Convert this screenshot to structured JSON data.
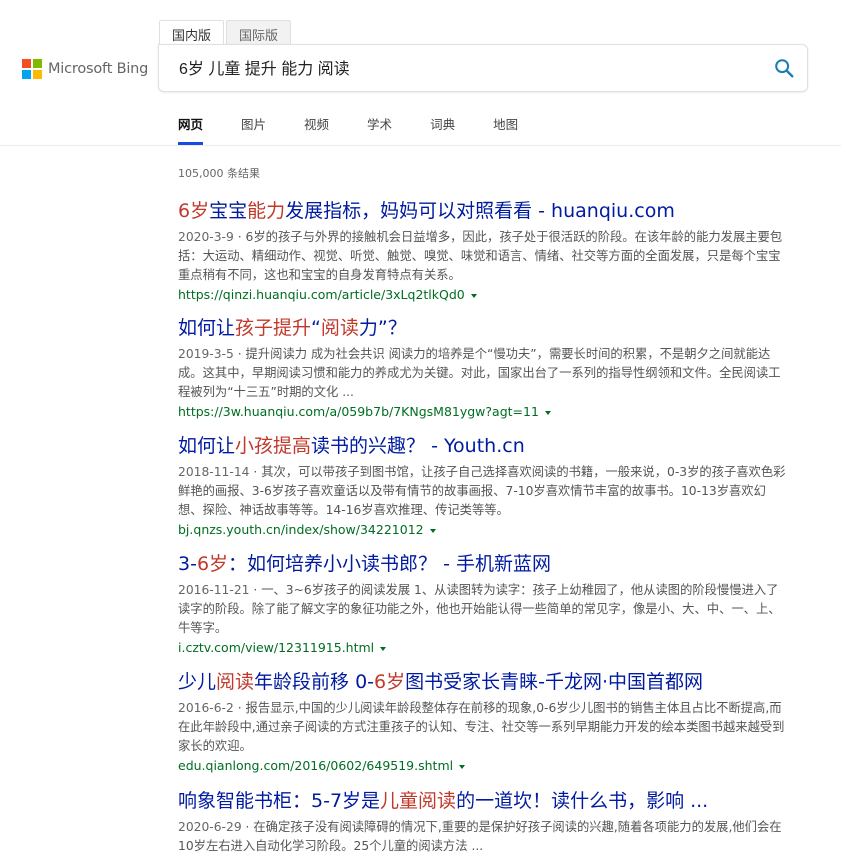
{
  "brand": {
    "logo_text": "Microsoft Bing",
    "colors": [
      "#f25022",
      "#7fba00",
      "#00a4ef",
      "#ffb900"
    ]
  },
  "scope_tabs": [
    {
      "label": "国内版",
      "active": true
    },
    {
      "label": "国际版",
      "active": false
    }
  ],
  "search": {
    "query": "6岁 儿童 提升 能力 阅读",
    "icon": "search-icon"
  },
  "nav": [
    {
      "label": "网页",
      "active": true
    },
    {
      "label": "图片",
      "active": false
    },
    {
      "label": "视频",
      "active": false
    },
    {
      "label": "学术",
      "active": false
    },
    {
      "label": "词典",
      "active": false
    },
    {
      "label": "地图",
      "active": false
    }
  ],
  "results_count": "105,000 条结果",
  "results": [
    {
      "title": [
        {
          "t": "6岁",
          "h": true
        },
        {
          "t": "宝宝",
          "h": false
        },
        {
          "t": "能力",
          "h": true
        },
        {
          "t": "发展指标，妈妈可以对照看看 - huanqiu.com",
          "h": false
        }
      ],
      "date": "2020-3-9",
      "snippet": "6岁的孩子与外界的接触机会日益增多，因此，孩子处于很活跃的阶段。在该年龄的能力发展主要包括：大运动、精细动作、视觉、听觉、触觉、嗅觉、味觉和语言、情绪、社交等方面的全面发展，只是每个宝宝重点稍有不同，这也和宝宝的自身发育特点有关系。",
      "url": "https://qinzi.huanqiu.com/article/3xLq2tlkQd0"
    },
    {
      "title": [
        {
          "t": "如何让",
          "h": false
        },
        {
          "t": "孩子提升",
          "h": true
        },
        {
          "t": "“",
          "h": false
        },
        {
          "t": "阅读",
          "h": true
        },
        {
          "t": "力”？",
          "h": false
        }
      ],
      "date": "2019-3-5",
      "snippet": "提升阅读力 成为社会共识 阅读力的培养是个“慢功夫”，需要长时间的积累，不是朝夕之间就能达成。这其中，早期阅读习惯和能力的养成尤为关键。对此，国家出台了一系列的指导性纲领和文件。全民阅读工程被列为“十三五”时期的文化 ...",
      "url": "https://3w.huanqiu.com/a/059b7b/7KNgsM81ygw?agt=11"
    },
    {
      "title": [
        {
          "t": "如何让",
          "h": false
        },
        {
          "t": "小孩提高",
          "h": true
        },
        {
          "t": "读书的兴趣？ - Youth.cn",
          "h": false
        }
      ],
      "date": "2018-11-14",
      "snippet": "其次，可以带孩子到图书馆，让孩子自己选择喜欢阅读的书籍，一般来说，0-3岁的孩子喜欢色彩鲜艳的画报、3-6岁孩子喜欢童话以及带有情节的故事画报、7-10岁喜欢情节丰富的故事书。10-13岁喜欢幻想、探险、神话故事等等。14-16岁喜欢推理、传记类等等。",
      "url": "bj.qnzs.youth.cn/index/show/34221012"
    },
    {
      "title": [
        {
          "t": "3-",
          "h": false
        },
        {
          "t": "6岁",
          "h": true
        },
        {
          "t": "：如何培养小小读书郎？ - 手机新蓝网",
          "h": false
        }
      ],
      "date": "2016-11-21",
      "snippet": "一、3~6岁孩子的阅读发展 1、从读图转为读字：孩子上幼稚园了，他从读图的阶段慢慢进入了读字的阶段。除了能了解文字的象征功能之外，他也开始能认得一些简单的常见字，像是小、大、中、一、上、牛等字。",
      "url": "i.cztv.com/view/12311915.html"
    },
    {
      "title": [
        {
          "t": "少儿",
          "h": false
        },
        {
          "t": "阅读",
          "h": true
        },
        {
          "t": "年龄段前移 0-",
          "h": false
        },
        {
          "t": "6岁",
          "h": true
        },
        {
          "t": "图书受家长青睐-千龙网·中国首都网",
          "h": false
        }
      ],
      "date": "2016-6-2",
      "snippet": "报告显示,中国的少儿阅读年龄段整体存在前移的现象,0-6岁少儿图书的销售主体且占比不断提高,而在此年龄段中,通过亲子阅读的方式注重孩子的认知、专注、社交等一系列早期能力开发的绘本类图书越来越受到家长的欢迎。",
      "url": "edu.qianlong.com/2016/0602/649519.shtml"
    },
    {
      "title": [
        {
          "t": "响象智能书柜：5-7岁是",
          "h": false
        },
        {
          "t": "儿童阅读",
          "h": true
        },
        {
          "t": "的一道坎！读什么书，影响 ...",
          "h": false
        }
      ],
      "date": "2020-6-29",
      "snippet": "在确定孩子没有阅读障碍的情况下,重要的是保护好孩子阅读的兴趣,随着各项能力的发展,他们会在10岁左右进入自动化学习阶段。25个儿童的阅读方法 ...",
      "url": ""
    }
  ]
}
